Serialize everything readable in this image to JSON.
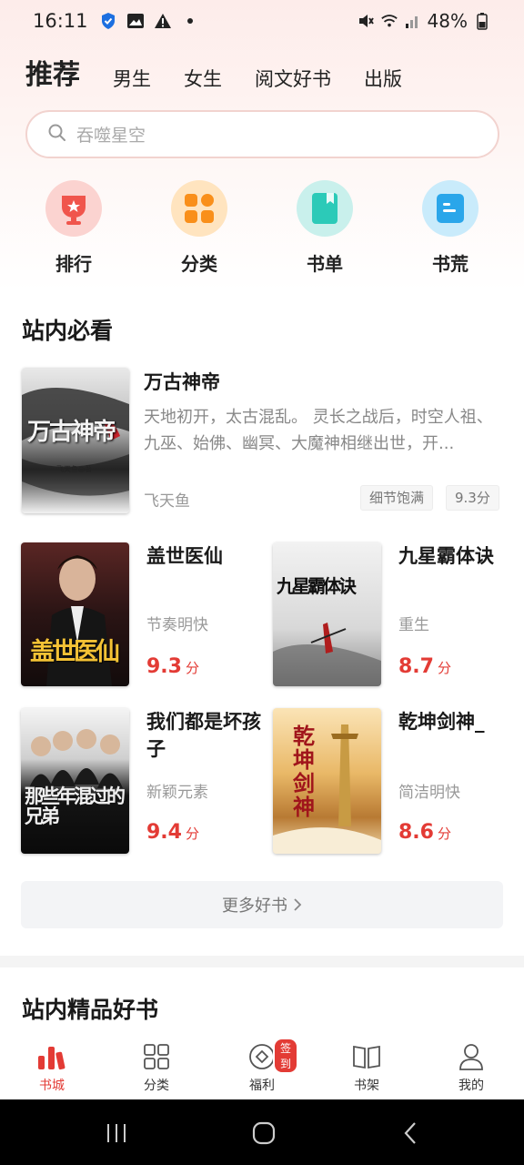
{
  "status_bar": {
    "time": "16:11",
    "battery": "48%"
  },
  "top_tabs": [
    {
      "label": "推荐",
      "active": true
    },
    {
      "label": "男生",
      "active": false
    },
    {
      "label": "女生",
      "active": false
    },
    {
      "label": "阅文好书",
      "active": false
    },
    {
      "label": "出版",
      "active": false
    }
  ],
  "search": {
    "placeholder": "吞噬星空"
  },
  "quick_entries": [
    {
      "label": "排行",
      "icon": "trophy-icon"
    },
    {
      "label": "分类",
      "icon": "grid-icon"
    },
    {
      "label": "书单",
      "icon": "book-list-icon"
    },
    {
      "label": "书荒",
      "icon": "book-shortage-icon"
    }
  ],
  "section1": {
    "title": "站内必看",
    "featured": {
      "title": "万古神帝",
      "description": "天地初开，太古混乱。 灵长之战后，时空人祖、九巫、始佛、幽冥、大魔神相继出世，开...",
      "author": "飞天鱼",
      "tags": [
        "细节饱满",
        "9.3分"
      ],
      "cover_text": "万古神帝",
      "cover_author": "飞天鱼◎著"
    },
    "books": [
      {
        "title": "盖世医仙",
        "tag": "节奏明快",
        "score": "9.3",
        "unit": "分",
        "cover_text": "盖世医仙"
      },
      {
        "title": "九星霸体诀",
        "tag": "重生",
        "score": "8.7",
        "unit": "分",
        "cover_text": "九星霸体诀"
      },
      {
        "title": "我们都是坏孩子",
        "tag": "新颖元素",
        "score": "9.4",
        "unit": "分",
        "cover_text": "那些年混过的兄弟"
      },
      {
        "title": "乾坤剑神_",
        "tag": "简洁明快",
        "score": "8.6",
        "unit": "分",
        "cover_text": "乾坤剑神"
      }
    ],
    "more_label": "更多好书"
  },
  "section2": {
    "title": "站内精品好书"
  },
  "bottom_nav": [
    {
      "label": "书城",
      "icon": "bookstore-icon",
      "active": true
    },
    {
      "label": "分类",
      "icon": "category-icon",
      "active": false
    },
    {
      "label": "福利",
      "icon": "welfare-icon",
      "active": false,
      "badge": "签到"
    },
    {
      "label": "书架",
      "icon": "bookshelf-icon",
      "active": false
    },
    {
      "label": "我的",
      "icon": "profile-icon",
      "active": false
    }
  ],
  "colors": {
    "accent": "#e33b35",
    "header_bg": "#fdecea"
  }
}
